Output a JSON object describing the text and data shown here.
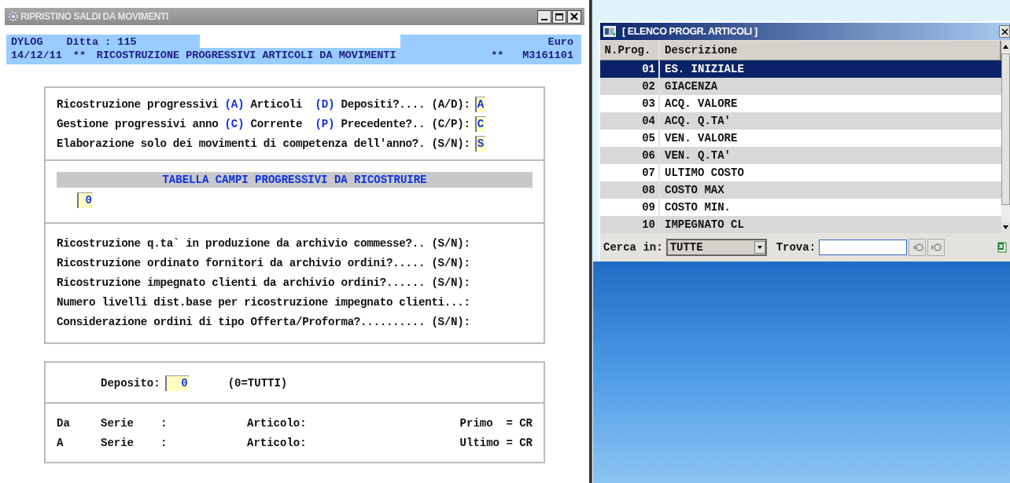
{
  "window": {
    "title": "RIPRISTINO SALDI DA MOVIMENTI"
  },
  "header": {
    "company": "DYLOG",
    "ditta": "Ditta :  115",
    "currency": "Euro",
    "date": "14/12/11",
    "mark_left": "**",
    "title": "RICOSTRUZIONE PROGRESSIVI ARTICOLI DA MOVIMENTI",
    "mark_right": "**",
    "code": "M3161101"
  },
  "options": [
    {
      "segments": [
        {
          "text": "Ricostruzione progressivi ",
          "highlight": false
        },
        {
          "text": "(A)",
          "highlight": true
        },
        {
          "text": " Articoli  ",
          "highlight": false
        },
        {
          "text": "(D)",
          "highlight": true
        },
        {
          "text": " Depositi?.... (A/D):",
          "highlight": false
        }
      ],
      "value": "A"
    },
    {
      "segments": [
        {
          "text": "Gestione progressivi anno ",
          "highlight": false
        },
        {
          "text": "(C)",
          "highlight": true
        },
        {
          "text": " Corrente  ",
          "highlight": false
        },
        {
          "text": "(P)",
          "highlight": true
        },
        {
          "text": " Precedente?.. (C/P):",
          "highlight": false
        }
      ],
      "value": "C"
    },
    {
      "segments": [
        {
          "text": "Elaborazione solo dei movimenti di competenza dell'anno?. (S/N):",
          "highlight": false
        }
      ],
      "value": "S"
    }
  ],
  "table_section": {
    "heading": "TABELLA CAMPI PROGRESSIVI DA RICOSTRUIRE",
    "value": "0"
  },
  "questions": [
    "Ricostruzione q.ta` in produzione da archivio commesse?.. (S/N):",
    "Ricostruzione ordinato fornitori da archivio ordini?..... (S/N):",
    "Ricostruzione impegnato clienti da archivio ordini?...... (S/N):",
    "Numero livelli dist.base per ricostruzione impegnato clienti...:",
    "Considerazione ordini di tipo Offerta/Proforma?.......... (S/N):"
  ],
  "deposito": {
    "label": "Deposito:",
    "value": "0",
    "hint": "(0=TUTTI)"
  },
  "range": [
    {
      "from": "Da",
      "serie": "Serie",
      "colon": ":",
      "articolo": "Articolo:",
      "note": "Primo  = CR"
    },
    {
      "from": "A",
      "serie": "Serie",
      "colon": ":",
      "articolo": "Articolo:",
      "note": "Ultimo = CR"
    }
  ],
  "dialog": {
    "title": "[ ELENCO PROGR. ARTICOLI ]",
    "columns": [
      "N.Prog.",
      "Descrizione"
    ],
    "rows": [
      {
        "num": "01",
        "desc": "ES. INIZIALE",
        "selected": true
      },
      {
        "num": "02",
        "desc": "GIACENZA",
        "selected": false
      },
      {
        "num": "03",
        "desc": "ACQ. VALORE",
        "selected": false
      },
      {
        "num": "04",
        "desc": "ACQ. Q.TA'",
        "selected": false
      },
      {
        "num": "05",
        "desc": "VEN. VALORE",
        "selected": false
      },
      {
        "num": "06",
        "desc": "VEN. Q.TA'",
        "selected": false
      },
      {
        "num": "07",
        "desc": "ULTIMO COSTO",
        "selected": false
      },
      {
        "num": "08",
        "desc": "COSTO MAX",
        "selected": false
      },
      {
        "num": "09",
        "desc": "COSTO MIN.",
        "selected": false
      },
      {
        "num": "10",
        "desc": "IMPEGNATO CL",
        "selected": false
      }
    ],
    "search_in_label": "Cerca in:",
    "search_in_value": "TUTTE",
    "find_label": "Trova:"
  }
}
